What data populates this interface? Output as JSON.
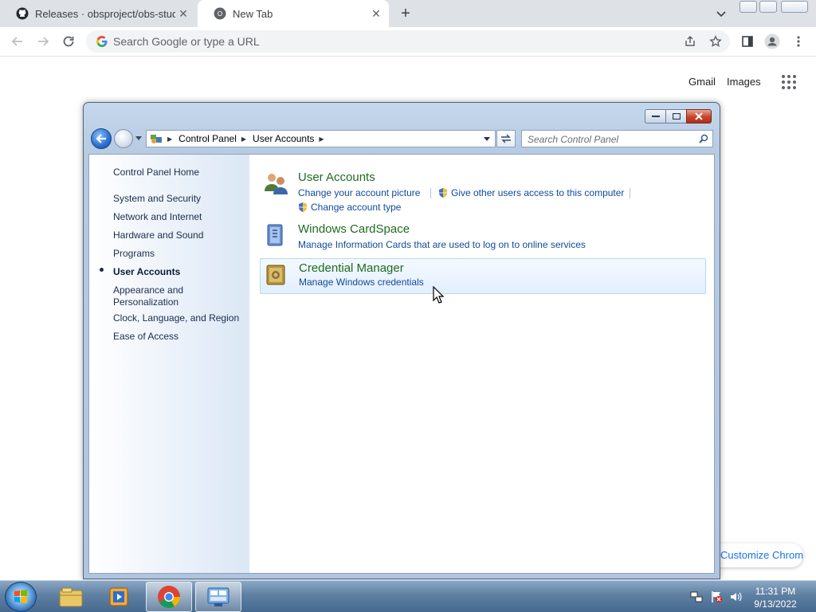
{
  "browser": {
    "tabs": [
      {
        "title": "Releases · obsproject/obs-studio",
        "close": "✕"
      },
      {
        "title": "New Tab",
        "close": "✕"
      }
    ],
    "new_tab": "+",
    "omnibox_placeholder": "Search Google or type a URL",
    "ntp": {
      "gmail": "Gmail",
      "images": "Images",
      "customize": "Customize Chrome"
    }
  },
  "control_panel": {
    "breadcrumb": [
      "Control Panel",
      "User Accounts"
    ],
    "search_placeholder": "Search Control Panel",
    "left_nav": {
      "home": "Control Panel Home",
      "items": [
        "System and Security",
        "Network and Internet",
        "Hardware and Sound",
        "Programs",
        "User Accounts",
        "Appearance and",
        "Personalization",
        "Clock, Language, and Region",
        "Ease of Access"
      ],
      "active_index": 4
    },
    "categories": [
      {
        "title": "User Accounts",
        "links": [
          "Change your account picture",
          "Give other users access to this computer",
          "Change account type"
        ]
      },
      {
        "title": "Windows CardSpace",
        "links": [
          "Manage Information Cards that are used to log on to online services"
        ]
      },
      {
        "title": "Credential Manager",
        "links": [
          "Manage Windows credentials"
        ]
      }
    ]
  },
  "taskbar": {
    "clock_time": "11:31 PM",
    "clock_date": "9/13/2022",
    "buttons": [
      "windows-explorer-icon",
      "media-player-icon",
      "chrome-icon",
      "control-panel-icon"
    ]
  },
  "colors": {
    "link": "#0f4a9c",
    "category_title": "#1e6b20",
    "taskbar": "#5f80a3"
  }
}
